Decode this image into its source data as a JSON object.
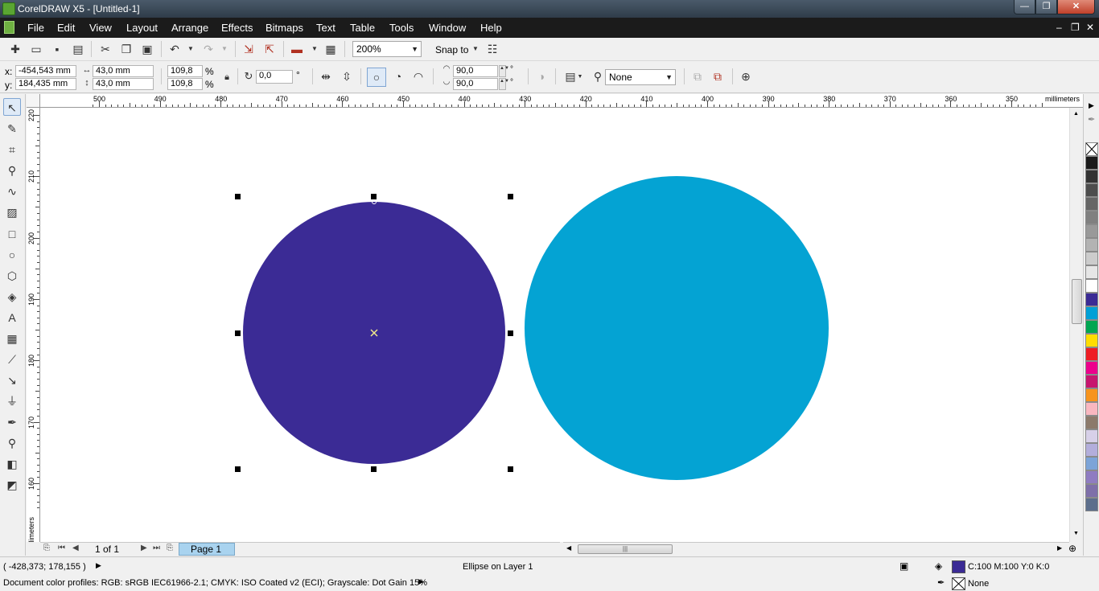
{
  "window": {
    "title": "CorelDRAW X5 - [Untitled-1]",
    "min_glyph": "—",
    "max_glyph": "❐",
    "close_glyph": "✕"
  },
  "menu": {
    "items": [
      "File",
      "Edit",
      "View",
      "Layout",
      "Arrange",
      "Effects",
      "Bitmaps",
      "Text",
      "Table",
      "Tools",
      "Window",
      "Help"
    ],
    "doc_min_glyph": "–",
    "doc_restore_glyph": "❐",
    "doc_close_glyph": "✕"
  },
  "standard_toolbar": {
    "zoom_value": "200%",
    "snap_to_label": "Snap to"
  },
  "property_bar": {
    "x_label": "x:",
    "x_value": "-454,543 mm",
    "y_label": "y:",
    "y_value": "184,435 mm",
    "width_value": "43,0 mm",
    "height_value": "43,0 mm",
    "scale_x": "109,8",
    "scale_y": "109,8",
    "percent_symbol": "%",
    "rotation_value": "0,0",
    "degree_symbol": "°",
    "start_angle": "90,0",
    "end_angle": "90,0",
    "outline_width": "None"
  },
  "rulers": {
    "units": "millimeters",
    "h_labels": [
      "500",
      "490",
      "480",
      "470",
      "460",
      "450",
      "440",
      "430",
      "420",
      "410",
      "400",
      "390",
      "380",
      "370",
      "360",
      "350"
    ],
    "v_labels": [
      "220",
      "210",
      "200",
      "190",
      "180",
      "170",
      "160"
    ]
  },
  "canvas": {
    "ellipse_left_color": "#3b2b95",
    "ellipse_right_color": "#04a3d3"
  },
  "palette": {
    "colors": [
      "#1a1a1a",
      "#333333",
      "#4d4d4d",
      "#666666",
      "#808080",
      "#999999",
      "#b3b3b3",
      "#cccccc",
      "#e6e6e6",
      "#ffffff",
      "#3b2b95",
      "#00a0d6",
      "#00a651",
      "#ffdd00",
      "#ee1c24",
      "#ec008c",
      "#c7166f",
      "#f7941d",
      "#f9b7c0",
      "#8c7a6b",
      "#d7d0e8",
      "#b3aedb",
      "#7ca4d8",
      "#8f7cc1",
      "#7e6fa9",
      "#5c6e8c"
    ]
  },
  "page_nav": {
    "page_count": "1 of 1",
    "page_tab": "Page 1"
  },
  "status": {
    "cursor_position": "( -428,373; 178,155 )",
    "object_info": "Ellipse on Layer 1",
    "color_profiles": "Document color profiles: RGB: sRGB IEC61966-2.1; CMYK: ISO Coated v2 (ECI); Grayscale: Dot Gain 15%",
    "fill_color": "#3b2b95",
    "fill_value": "C:100 M:100 Y:0 K:0",
    "outline_value": "None"
  }
}
